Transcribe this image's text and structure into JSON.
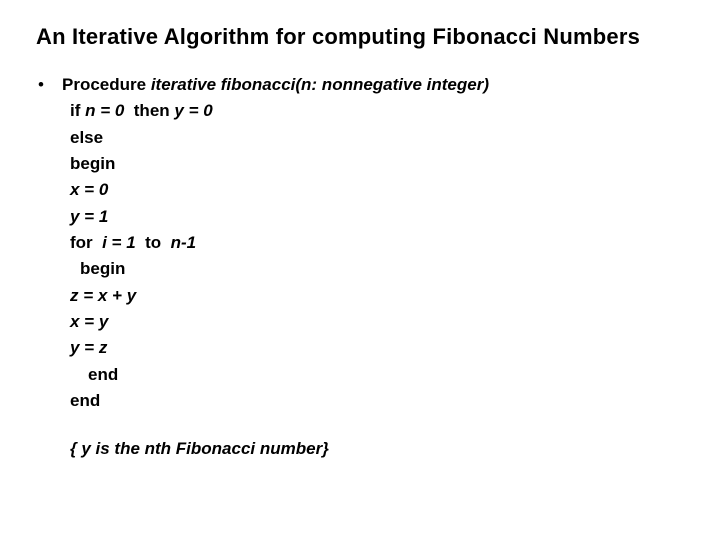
{
  "title": "An Iterative Algorithm for computing Fibonacci Numbers",
  "bullet": "•",
  "proc": {
    "label": "Procedure",
    "signature": "iterative fibonacci(n: nonnegative integer)"
  },
  "lines": {
    "l1a": "if ",
    "l1b": "n = 0 ",
    "l1c": " then ",
    "l1d": "y = 0",
    "l2": "else",
    "l3": "begin",
    "l4": "x = 0",
    "l5": "y = 1",
    "l6a": "for  ",
    "l6b": "i = 1 ",
    "l6c": " to  ",
    "l6d": "n-1",
    "l7": "begin",
    "l8": "z = x + y",
    "l9": "x = y",
    "l10": "y = z",
    "l11": "end",
    "l12": "end"
  },
  "footer": "{ y is the nth Fibonacci number}"
}
